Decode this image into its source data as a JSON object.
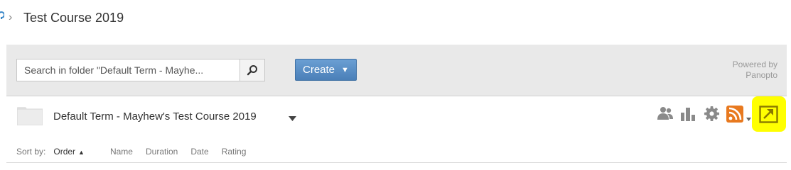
{
  "breadcrumb": {
    "separator": "›",
    "title": "Test Course 2019"
  },
  "toolbar": {
    "search_placeholder": "Search in folder \"Default Term - Mayhe...",
    "create_label": "Create",
    "powered_line1": "Powered by",
    "powered_line2": "Panopto"
  },
  "folder": {
    "name": "Default Term - Mayhew's Test Course 2019"
  },
  "sort": {
    "label": "Sort by:",
    "options": [
      "Order",
      "Name",
      "Duration",
      "Date",
      "Rating"
    ],
    "active": "Order"
  },
  "colors": {
    "create_button": "#5289c1",
    "rss_orange": "#e8791f",
    "highlight": "#ffff00",
    "icon_gray": "#8a8a8a"
  },
  "icons": [
    "search-icon",
    "folder-icon",
    "chevron-down-icon",
    "users-icon",
    "stats-icon",
    "gear-icon",
    "rss-icon",
    "external-link-icon"
  ]
}
